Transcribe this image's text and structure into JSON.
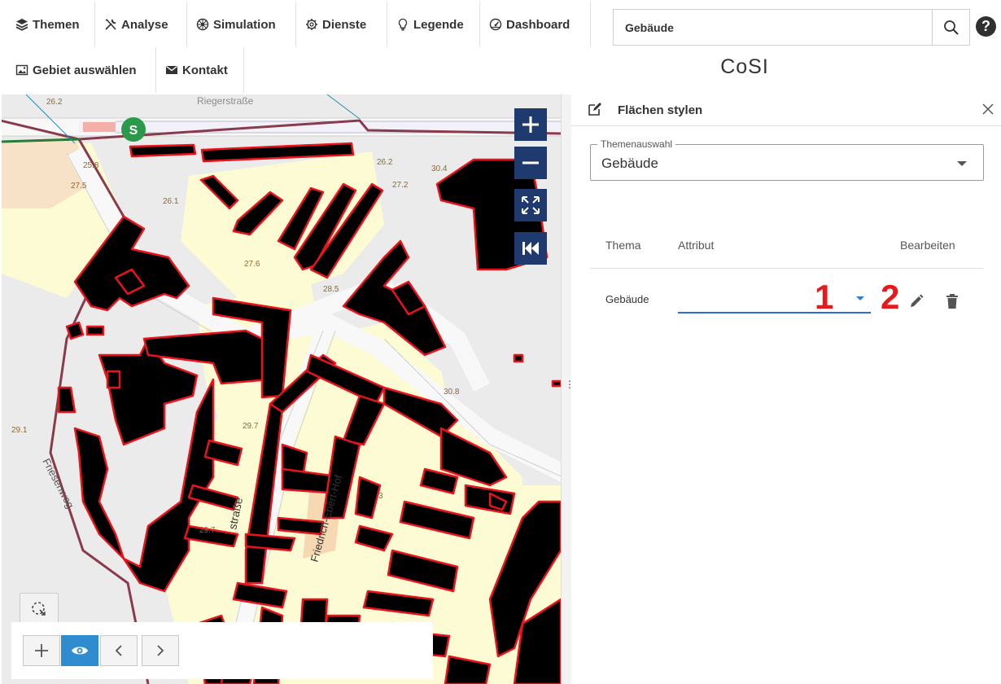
{
  "menu": {
    "items": [
      {
        "label": "Themen",
        "icon": "layers-icon"
      },
      {
        "label": "Analyse",
        "icon": "tools-icon"
      },
      {
        "label": "Simulation",
        "icon": "network-icon"
      },
      {
        "label": "Dienste",
        "icon": "gear-icon"
      },
      {
        "label": "Legende",
        "icon": "lightbulb-icon"
      },
      {
        "label": "Dashboard",
        "icon": "gauge-icon"
      }
    ],
    "items_row2": [
      {
        "label": "Gebiet auswählen",
        "icon": "image-icon"
      },
      {
        "label": "Kontakt",
        "icon": "envelope-icon"
      }
    ]
  },
  "search": {
    "value": "Gebäude"
  },
  "help_label": "?",
  "portal_title": "CoSI",
  "map": {
    "labels": {
      "l1": "26.2",
      "l2": "25.8",
      "l3": "27.5",
      "l4": "26.1",
      "l5": "26.2",
      "l6": "30.4",
      "l7": "27.2",
      "l8": "27.6",
      "l9": "28.5",
      "l10": "30.8",
      "l11": "29.7",
      "l12": "29.7",
      "l13": "29.1",
      "l14": "3",
      "street1": "straße",
      "street2": "Friedrich-Ebert-Hof",
      "street3": "Friesenweg",
      "street4": "Riegerstraße",
      "sbahn": "S"
    },
    "colors": {
      "building": "#000000",
      "outline": "#e8141c",
      "block": "#fdfbd3",
      "road": "#f7f7f7",
      "boundary": "#8a3a4d"
    }
  },
  "panel": {
    "title": "Flächen stylen",
    "select_legend": "Themenauswahl",
    "select_value": "Gebäude",
    "table": {
      "headers": [
        "Thema",
        "Attribut",
        "Bearbeiten"
      ],
      "rows": [
        {
          "theme": "Gebäude",
          "attribute": ""
        }
      ]
    },
    "annotations": [
      "1",
      "2"
    ]
  }
}
